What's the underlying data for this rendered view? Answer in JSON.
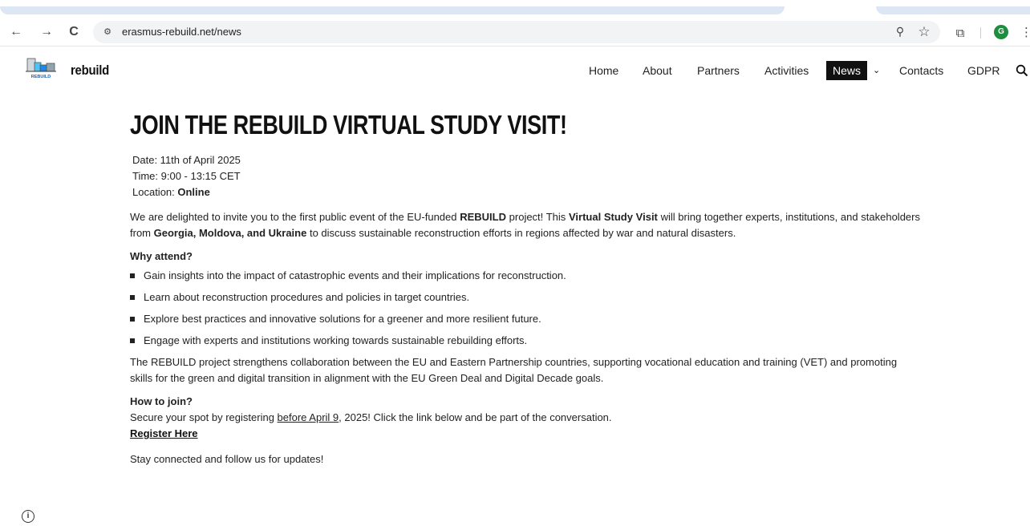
{
  "browser": {
    "url": "erasmus-rebuild.net/news",
    "profile_initial": "G",
    "back_icon": "←",
    "forward_icon": "→",
    "reload_icon": "C",
    "site_info_icon": "⚙",
    "zoom_icon": "⚲",
    "bookmark_icon": "☆",
    "extensions_icon": "⧉",
    "menu_icon": "⋮"
  },
  "site": {
    "brand": "rebuild",
    "logo_caption": "REBUILD",
    "nav": [
      {
        "label": "Home"
      },
      {
        "label": "About"
      },
      {
        "label": "Partners"
      },
      {
        "label": "Activities"
      },
      {
        "label": "News",
        "active": true
      },
      {
        "label": "Contacts"
      },
      {
        "label": "GDPR"
      }
    ],
    "chevron": "⌄",
    "search_icon": "🔍"
  },
  "article": {
    "title": "JOIN THE REBUILD VIRTUAL STUDY VISIT!",
    "date_line": "Date: 11th  of April 2025",
    "time_line": "Time: 9:00 - 13:15 CET",
    "location_label": "Location: ",
    "location_value": "Online",
    "intro": {
      "t1": "We are delighted to invite you to the first public event of the EU-funded ",
      "b1": "REBUILD",
      "t2": " project! This ",
      "b2": "Virtual Study Visit",
      "t3": " will bring together experts, institutions, and stakeholders from ",
      "b3": "Georgia, Moldova, and Ukraine",
      "t4": " to discuss sustainable reconstruction efforts in regions affected by war and natural disasters."
    },
    "why_heading": "Why attend?",
    "bullets": [
      "Gain insights into the impact of catastrophic events and their implications for reconstruction.",
      "Learn about reconstruction procedures and policies in target countries.",
      "Explore best practices and innovative solutions for a greener and more resilient future.",
      "Engage with experts and institutions working towards sustainable rebuilding efforts."
    ],
    "project_para": "The REBUILD project strengthens collaboration between the EU and Eastern Partnership countries, supporting vocational education and training (VET) and promoting skills for the green and digital transition in alignment with the EU Green Deal and Digital Decade goals.",
    "join_heading": "How to join?",
    "join_t1": "Secure your spot by registering ",
    "join_u": "before April 9",
    "join_t2": ", 2025! Click the link below and be part of the conversation.",
    "register_label": "Register Here",
    "stay": "Stay connected and follow us for updates!"
  },
  "floating": {
    "info_icon": "i"
  },
  "colors": {
    "tab_strip": "#dde6f5",
    "omnibox": "#f1f3f4",
    "profile": "#1e8e3e",
    "nav_active_bg": "#111111",
    "text": "#222222"
  }
}
